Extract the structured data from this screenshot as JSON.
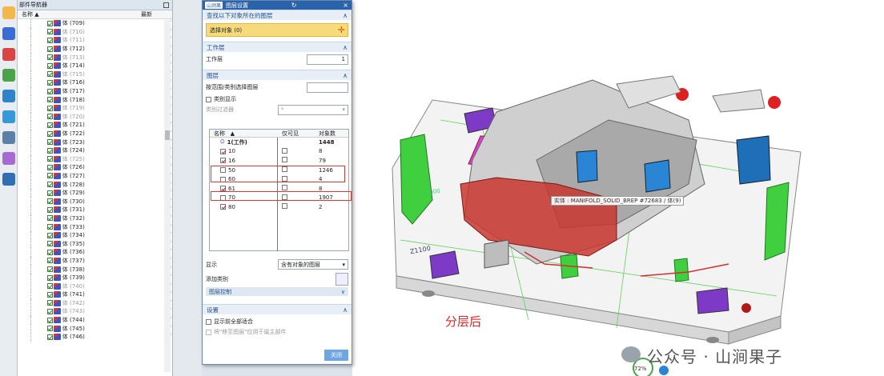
{
  "nav": {
    "title": "部件导航器",
    "col_name": "名称",
    "col_latest": "最新",
    "rows": [
      {
        "label": "体 (709)",
        "dim": false
      },
      {
        "label": "体 (710)",
        "dim": true
      },
      {
        "label": "体 (711)",
        "dim": true
      },
      {
        "label": "体 (712)",
        "dim": false
      },
      {
        "label": "体 (713)",
        "dim": true
      },
      {
        "label": "体 (714)",
        "dim": false
      },
      {
        "label": "体 (715)",
        "dim": true
      },
      {
        "label": "体 (716)",
        "dim": false
      },
      {
        "label": "体 (717)",
        "dim": false
      },
      {
        "label": "体 (718)",
        "dim": false
      },
      {
        "label": "体 (719)",
        "dim": true
      },
      {
        "label": "体 (720)",
        "dim": true
      },
      {
        "label": "体 (721)",
        "dim": false
      },
      {
        "label": "体 (722)",
        "dim": false
      },
      {
        "label": "体 (723)",
        "dim": false
      },
      {
        "label": "体 (724)",
        "dim": false
      },
      {
        "label": "体 (725)",
        "dim": true
      },
      {
        "label": "体 (726)",
        "dim": false
      },
      {
        "label": "体 (727)",
        "dim": false
      },
      {
        "label": "体 (728)",
        "dim": false
      },
      {
        "label": "体 (729)",
        "dim": false
      },
      {
        "label": "体 (730)",
        "dim": false
      },
      {
        "label": "体 (731)",
        "dim": false
      },
      {
        "label": "体 (732)",
        "dim": false
      },
      {
        "label": "体 (733)",
        "dim": false
      },
      {
        "label": "体 (734)",
        "dim": false
      },
      {
        "label": "体 (735)",
        "dim": false
      },
      {
        "label": "体 (736)",
        "dim": false
      },
      {
        "label": "体 (737)",
        "dim": false
      },
      {
        "label": "体 (738)",
        "dim": false
      },
      {
        "label": "体 (739)",
        "dim": false
      },
      {
        "label": "体 (740)",
        "dim": true
      },
      {
        "label": "体 (741)",
        "dim": false
      },
      {
        "label": "体 (742)",
        "dim": true
      },
      {
        "label": "体 (743)",
        "dim": true
      },
      {
        "label": "体 (744)",
        "dim": false
      },
      {
        "label": "体 (745)",
        "dim": false
      },
      {
        "label": "体 (746)",
        "dim": false
      }
    ]
  },
  "dialog": {
    "logo": "山涧果",
    "title": "图层设置",
    "find_section": "查找以下对象所在的图层",
    "select_object": "选择对象 (0)",
    "work_layer_section": "工作层",
    "work_layer_label": "工作层",
    "work_layer_value": "1",
    "layer_section": "图层",
    "range_label": "按范围/类别选择图层",
    "category_display": "类别显示",
    "category_filter": "类别过滤器",
    "category_filter_value": "*",
    "col_name": "名称",
    "col_visible_only": "仅可见",
    "col_count": "对象数",
    "layers": [
      {
        "name": "1(工作)",
        "count": "1448",
        "checked": true,
        "work": true
      },
      {
        "name": "10",
        "count": "8",
        "checked": true
      },
      {
        "name": "16",
        "count": "79",
        "checked": true
      },
      {
        "name": "50",
        "count": "1246",
        "checked": false
      },
      {
        "name": "60",
        "count": "4",
        "checked": false
      },
      {
        "name": "61",
        "count": "8",
        "checked": true
      },
      {
        "name": "70",
        "count": "1907",
        "checked": false
      },
      {
        "name": "80",
        "count": "2",
        "checked": true
      }
    ],
    "display_label": "显示",
    "display_value": "含有对象的图层",
    "add_category": "添加类别",
    "layer_control": "图层控制",
    "settings_section": "设置",
    "show_all_previews": "显示前全部适合",
    "fit_assembly": "将\"移至图层\"应用于属主部件",
    "close_button": "关闭"
  },
  "viewport": {
    "tooltip": "实体 : MANIFOLD_SOLID_BREP #72683 / 体(9)",
    "overlay_text": "分层后",
    "watermark": "公众号 · 山涧果子",
    "zoom": "72%",
    "label_1000": "1000",
    "label_z1100": "Z1100"
  }
}
